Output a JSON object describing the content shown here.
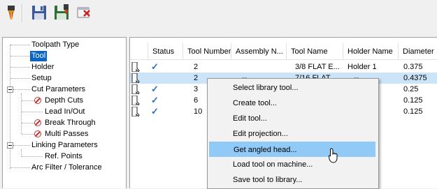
{
  "toolbar": {
    "icons": [
      "tool-holder-icon",
      "save-icon",
      "save-to-library-icon",
      "delete-icon"
    ]
  },
  "tree": {
    "items": [
      {
        "label": "Toolpath Type",
        "icon": null
      },
      {
        "label": "Tool",
        "icon": null,
        "selected": true
      },
      {
        "label": "Holder",
        "icon": null
      },
      {
        "label": "Setup",
        "icon": null
      },
      {
        "label": "Cut Parameters",
        "icon": null,
        "expander": true
      },
      {
        "label": "Depth Cuts",
        "icon": "disabled-icon"
      },
      {
        "label": "Lead In/Out",
        "icon": null
      },
      {
        "label": "Break Through",
        "icon": "disabled-icon"
      },
      {
        "label": "Multi Passes",
        "icon": "disabled-icon"
      },
      {
        "label": "Linking Parameters",
        "icon": null,
        "expander": true
      },
      {
        "label": "Ref. Points",
        "icon": null
      },
      {
        "label": "Arc Filter / Tolerance",
        "icon": null
      }
    ]
  },
  "grid": {
    "columns": [
      "Status",
      "Tool Number",
      "Assembly N...",
      "Tool Name",
      "Holder Name",
      "Diameter"
    ],
    "rows": [
      {
        "status": "✓",
        "tool_number": "2",
        "assembly": "",
        "tool_name": "3/8 FLAT E...",
        "holder": "Holder 1",
        "diameter": "0.375"
      },
      {
        "status": "",
        "tool_number": "2",
        "assembly": "--",
        "tool_name": "7/16 FLAT ...",
        "holder": "--",
        "diameter": "0.4375"
      },
      {
        "status": "✓",
        "tool_number": "3",
        "assembly": "",
        "tool_name": "",
        "holder": "",
        "diameter": "0.25"
      },
      {
        "status": "✓",
        "tool_number": "6",
        "assembly": "",
        "tool_name": "",
        "holder": "",
        "diameter": "0.125"
      },
      {
        "status": "✓",
        "tool_number": "10",
        "assembly": "",
        "tool_name": "",
        "holder": "",
        "diameter": "0.125"
      }
    ]
  },
  "context_menu": {
    "items": [
      "Select library tool...",
      "Create tool...",
      "Edit tool...",
      "Edit projection...",
      "Get angled head...",
      "Load tool on machine...",
      "Save tool to library..."
    ],
    "hover_index": 4
  }
}
